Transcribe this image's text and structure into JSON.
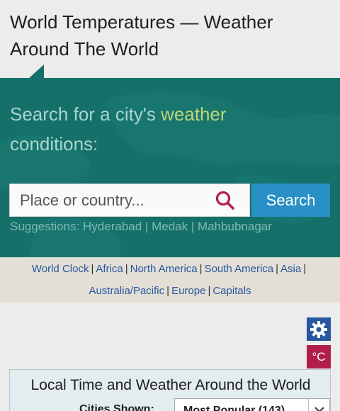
{
  "page": {
    "title": "World Temperatures — Weather Around The World"
  },
  "search": {
    "heading_main": "Search for a city's ",
    "heading_accent": "weather",
    "heading_rest": "conditions:",
    "placeholder": "Place or country...",
    "value": "",
    "button_label": "Search",
    "suggestions_label": "Suggestions:",
    "suggestions": [
      "Hyderabad",
      "Medak",
      "Mahbubnagar"
    ]
  },
  "regions": {
    "items": [
      "World Clock",
      "Africa",
      "North America",
      "South America",
      "Asia",
      "Australia/Pacific",
      "Europe",
      "Capitals"
    ]
  },
  "controls": {
    "settings_icon": "gear-icon",
    "unit_label": "°C"
  },
  "table": {
    "title": "Local Time and Weather Around the World",
    "cities_label": "Cities Shown:",
    "cities_selected": "Most Popular (143)"
  },
  "colors": {
    "hero_bg": "#16706a",
    "search_button": "#2a8fc5",
    "link": "#27579e",
    "settings_button": "#27579e",
    "unit_button": "#b21e4a",
    "search_icon": "#b21e4a",
    "accent_text": "#bcd67a"
  }
}
